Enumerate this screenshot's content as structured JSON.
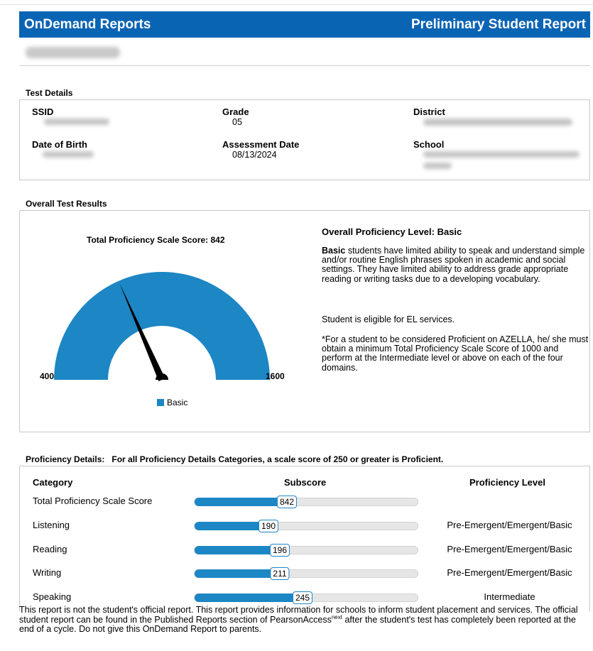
{
  "header": {
    "left_title": "OnDemand Reports",
    "right_title": "Preliminary Student Report"
  },
  "test_details": {
    "section_title": "Test Details",
    "ssid_label": "SSID",
    "grade_label": "Grade",
    "grade_value": "05",
    "district_label": "District",
    "dob_label": "Date of Birth",
    "assessment_date_label": "Assessment Date",
    "assessment_date_value": "08/13/2024",
    "school_label": "School"
  },
  "overall": {
    "section_title": "Overall Test Results",
    "gauge_title": "Total Proficiency Scale Score: 842",
    "gauge_min": "400",
    "gauge_max": "1600",
    "legend_label": "Basic",
    "level_heading": "Overall Proficiency Level: Basic",
    "desc_bold": "Basic",
    "desc_rest": " students have limited ability to speak and understand simple and/or routine English phrases spoken in academic and social settings. They have limited ability to address grade appropriate reading or writing tasks due to a developing vocabulary.",
    "eligibility": "Student is eligible for EL services.",
    "note": "*For a student to be considered Proficient on AZELLA, he/ she must obtain a minimum Total Proficiency Scale Score of 1000 and perform at the Intermediate level or above on each of the four domains."
  },
  "chart_data": {
    "type": "gauge",
    "title": "Total Proficiency Scale Score: 842",
    "min": 400,
    "max": 1600,
    "value": 842,
    "legend": [
      "Basic"
    ],
    "colors": {
      "fill": "#1d86c4",
      "needle": "#000000"
    }
  },
  "details": {
    "section_title": "Proficiency Details:   For all Proficiency Details Categories, a scale score of 250 or greater is Proficient.",
    "col_category": "Category",
    "col_subscore": "Subscore",
    "col_level": "Proficiency Level",
    "rows": [
      {
        "category": "Total Proficiency Scale Score",
        "value": 842,
        "display": "842",
        "fill_fraction": 0.41,
        "level": ""
      },
      {
        "category": "Listening",
        "value": 190,
        "display": "190",
        "fill_fraction": 0.33,
        "level": "Pre-Emergent/Emergent/Basic"
      },
      {
        "category": "Reading",
        "value": 196,
        "display": "196",
        "fill_fraction": 0.38,
        "level": "Pre-Emergent/Emergent/Basic"
      },
      {
        "category": "Writing",
        "value": 211,
        "display": "211",
        "fill_fraction": 0.38,
        "level": "Pre-Emergent/Emergent/Basic"
      },
      {
        "category": "Speaking",
        "value": 245,
        "display": "245",
        "fill_fraction": 0.48,
        "level": "Intermediate"
      }
    ]
  },
  "footer": {
    "text_part1": "This report is not the student's official report. This report provides information for schools to inform student placement and services. The official student report can be found in the Published Reports section of PearsonAccess",
    "text_sup": "next",
    "text_part2": " after the student's test has completely been reported at the end of a cycle. Do not give this OnDemand Report to parents."
  },
  "colors": {
    "header_bg": "#0a64b4",
    "bar_fill": "#1d86c4",
    "track": "#e6e6e6"
  }
}
